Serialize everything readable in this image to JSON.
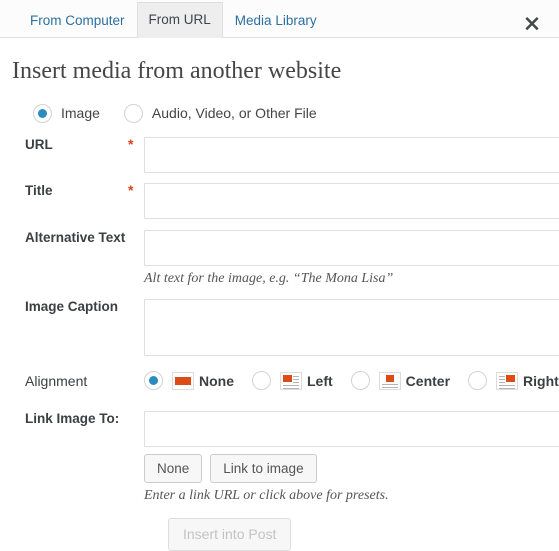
{
  "tabs": [
    {
      "label": "From Computer",
      "active": false
    },
    {
      "label": "From URL",
      "active": true
    },
    {
      "label": "Media Library",
      "active": false
    }
  ],
  "close_icon": "close-icon",
  "title": "Insert media from another website",
  "media_types": [
    {
      "label": "Image",
      "selected": true
    },
    {
      "label": "Audio, Video, or Other File",
      "selected": false
    }
  ],
  "fields": {
    "url": {
      "label": "URL",
      "required": "*",
      "value": "",
      "placeholder": ""
    },
    "title": {
      "label": "Title",
      "required": "*",
      "value": "",
      "placeholder": ""
    },
    "alt": {
      "label": "Alternative Text",
      "value": "",
      "placeholder": "",
      "hint": "Alt text for the image, e.g. “The Mona Lisa”"
    },
    "caption": {
      "label": "Image Caption",
      "value": "",
      "placeholder": ""
    },
    "link": {
      "label": "Link Image To:",
      "value": "",
      "placeholder": "",
      "hint": "Enter a link URL or click above for presets.",
      "buttons": [
        {
          "label": "None"
        },
        {
          "label": "Link to image"
        }
      ]
    }
  },
  "alignment": {
    "label": "Alignment",
    "options": [
      {
        "label": "None",
        "icon": "align-none-icon",
        "selected": true
      },
      {
        "label": "Left",
        "icon": "align-left-icon",
        "selected": false
      },
      {
        "label": "Center",
        "icon": "align-center-icon",
        "selected": false
      },
      {
        "label": "Right",
        "icon": "align-right-icon",
        "selected": false
      }
    ]
  },
  "submit": {
    "label": "Insert into Post",
    "disabled": true
  },
  "colors": {
    "accent_blue": "#2a8bbe",
    "link_blue": "#2b70a0",
    "required_red": "#e2401c",
    "icon_orange": "#dd4b16",
    "border_gray": "#dfdfdf"
  }
}
